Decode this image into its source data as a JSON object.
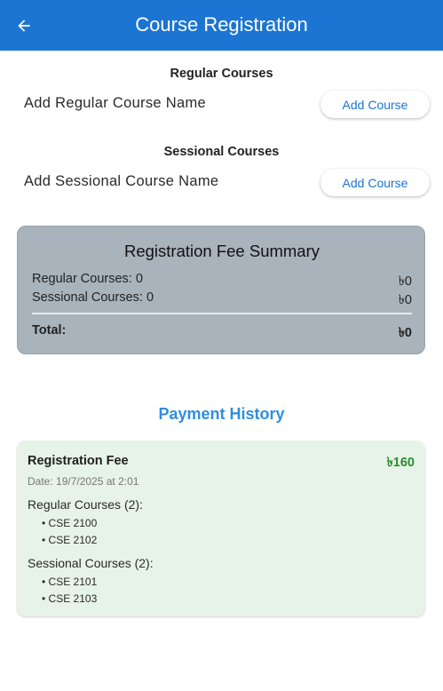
{
  "appbar": {
    "title": "Course Registration",
    "back_icon": "arrow-left-icon"
  },
  "regular": {
    "section_title": "Regular Courses",
    "input_label": "Add Regular Course Name",
    "button_label": "Add Course"
  },
  "sessional": {
    "section_title": "Sessional Courses",
    "input_label": "Add Sessional Course Name",
    "button_label": "Add Course"
  },
  "fee_summary": {
    "title": "Registration Fee Summary",
    "regular_label": "Regular Courses: 0",
    "regular_amount": "৳0",
    "sessional_label": "Sessional Courses: 0",
    "sessional_amount": "৳0",
    "total_label": "Total:",
    "total_amount": "৳0"
  },
  "payment_history": {
    "title": "Payment History",
    "entries": [
      {
        "title": "Registration Fee",
        "amount": "৳160",
        "date": "Date: 19/7/2025 at 2:01",
        "regular_header": "Regular Courses (2):",
        "regular_items": [
          "• CSE 2100",
          "• CSE 2102"
        ],
        "sessional_header": "Sessional Courses (2):",
        "sessional_items": [
          "• CSE 2101",
          "• CSE 2103"
        ]
      }
    ]
  },
  "colors": {
    "primary": "#1c75d2",
    "summary_card": "#a9b3bc",
    "history_title": "#2e8ee0",
    "payment_card": "#e6f3e6",
    "amount_green": "#2e8b32"
  }
}
